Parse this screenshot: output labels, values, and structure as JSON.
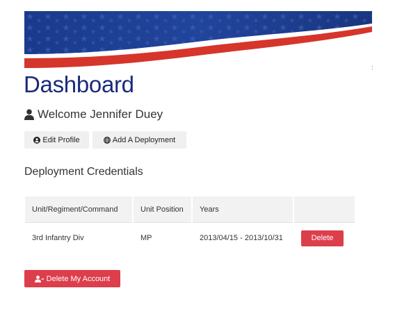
{
  "page": {
    "title": "Dashboard",
    "welcome": "Welcome Jennifer Duey",
    "stray_mark": ":"
  },
  "actions": {
    "edit_profile": "Edit Profile",
    "add_deployment": "Add A Deployment"
  },
  "credentials": {
    "section_title": "Deployment Credentials",
    "columns": [
      "Unit/Regiment/Command",
      "Unit Position",
      "Years",
      ""
    ],
    "rows": [
      {
        "unit": "3rd Infantry Div",
        "position": "MP",
        "years": "2013/04/15 - 2013/10/31",
        "delete_label": "Delete"
      }
    ]
  },
  "account": {
    "delete_account_label": "Delete My Account"
  },
  "icons": {
    "welcome": "user-icon",
    "edit_profile": "user-circle-icon",
    "add_deployment": "globe-icon",
    "delete_account": "user-minus-icon"
  },
  "colors": {
    "title": "#1a2a7a",
    "danger": "#dc3e4c",
    "banner_blue": "#1d3c8f",
    "banner_red": "#d6352b"
  }
}
